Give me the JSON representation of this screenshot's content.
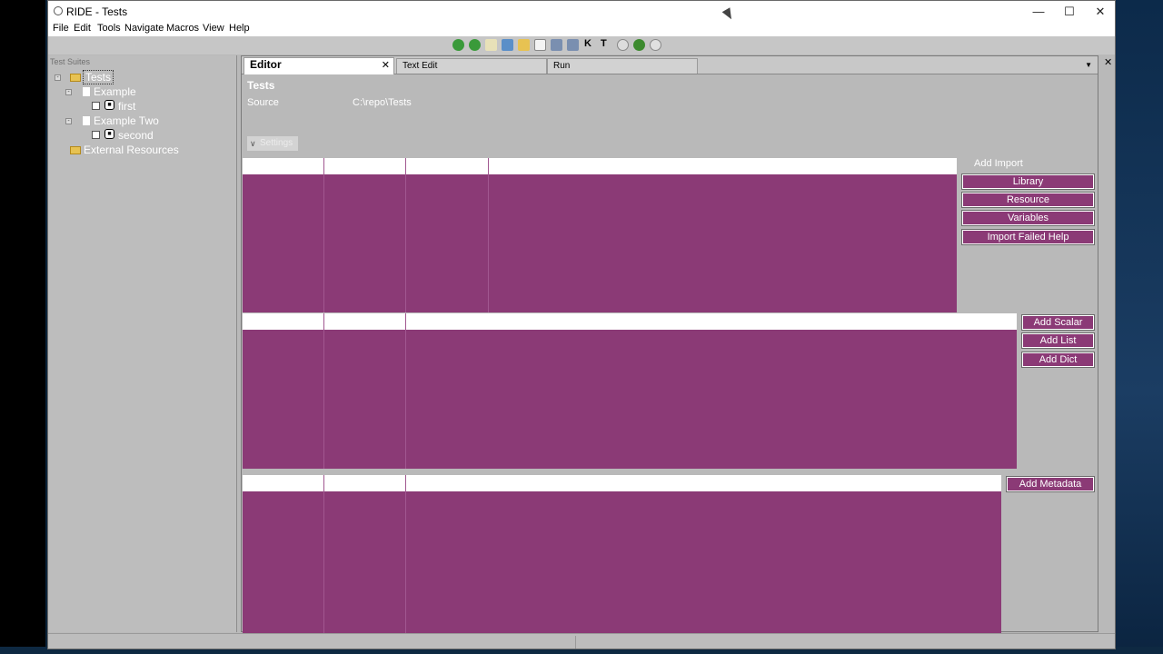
{
  "window": {
    "title": "RIDE - Tests"
  },
  "menu": [
    "File",
    "Edit",
    "Tools",
    "Navigate",
    "Macros",
    "View",
    "Help"
  ],
  "toolbar": {
    "icons": [
      "back-icon",
      "forward-icon",
      "new-project-icon",
      "open-test-suite-icon",
      "open-directory-icon",
      "new-resource-icon",
      "save-icon",
      "save-all-icon",
      "search-keywords-icon",
      "search-tests-icon",
      "run-icon",
      "debug-icon",
      "stop-icon"
    ],
    "k_label": "K",
    "t_label": "T"
  },
  "tree": {
    "header": "Test Suites",
    "root": "Tests",
    "children": [
      {
        "label": "Example",
        "tests": [
          "first"
        ]
      },
      {
        "label": "Example Two",
        "tests": [
          "second"
        ]
      }
    ],
    "external": "External Resources"
  },
  "tabs": [
    {
      "label": "Editor",
      "active": true
    },
    {
      "label": "Text Edit",
      "active": false
    },
    {
      "label": "Run",
      "active": false
    }
  ],
  "editor": {
    "suite_name": "Tests",
    "source_label": "Source",
    "source_value": "C:\\repo\\Tests",
    "settings_toggle": "Settings"
  },
  "imports": {
    "add_label": "Add Import",
    "buttons": [
      "Library",
      "Resource",
      "Variables",
      "Import Failed Help"
    ]
  },
  "variables": {
    "buttons": [
      "Add Scalar",
      "Add List",
      "Add Dict"
    ]
  },
  "metadata": {
    "button": "Add Metadata"
  },
  "colors": {
    "grid": "#8b3a76",
    "background": "#b9b9b9"
  }
}
